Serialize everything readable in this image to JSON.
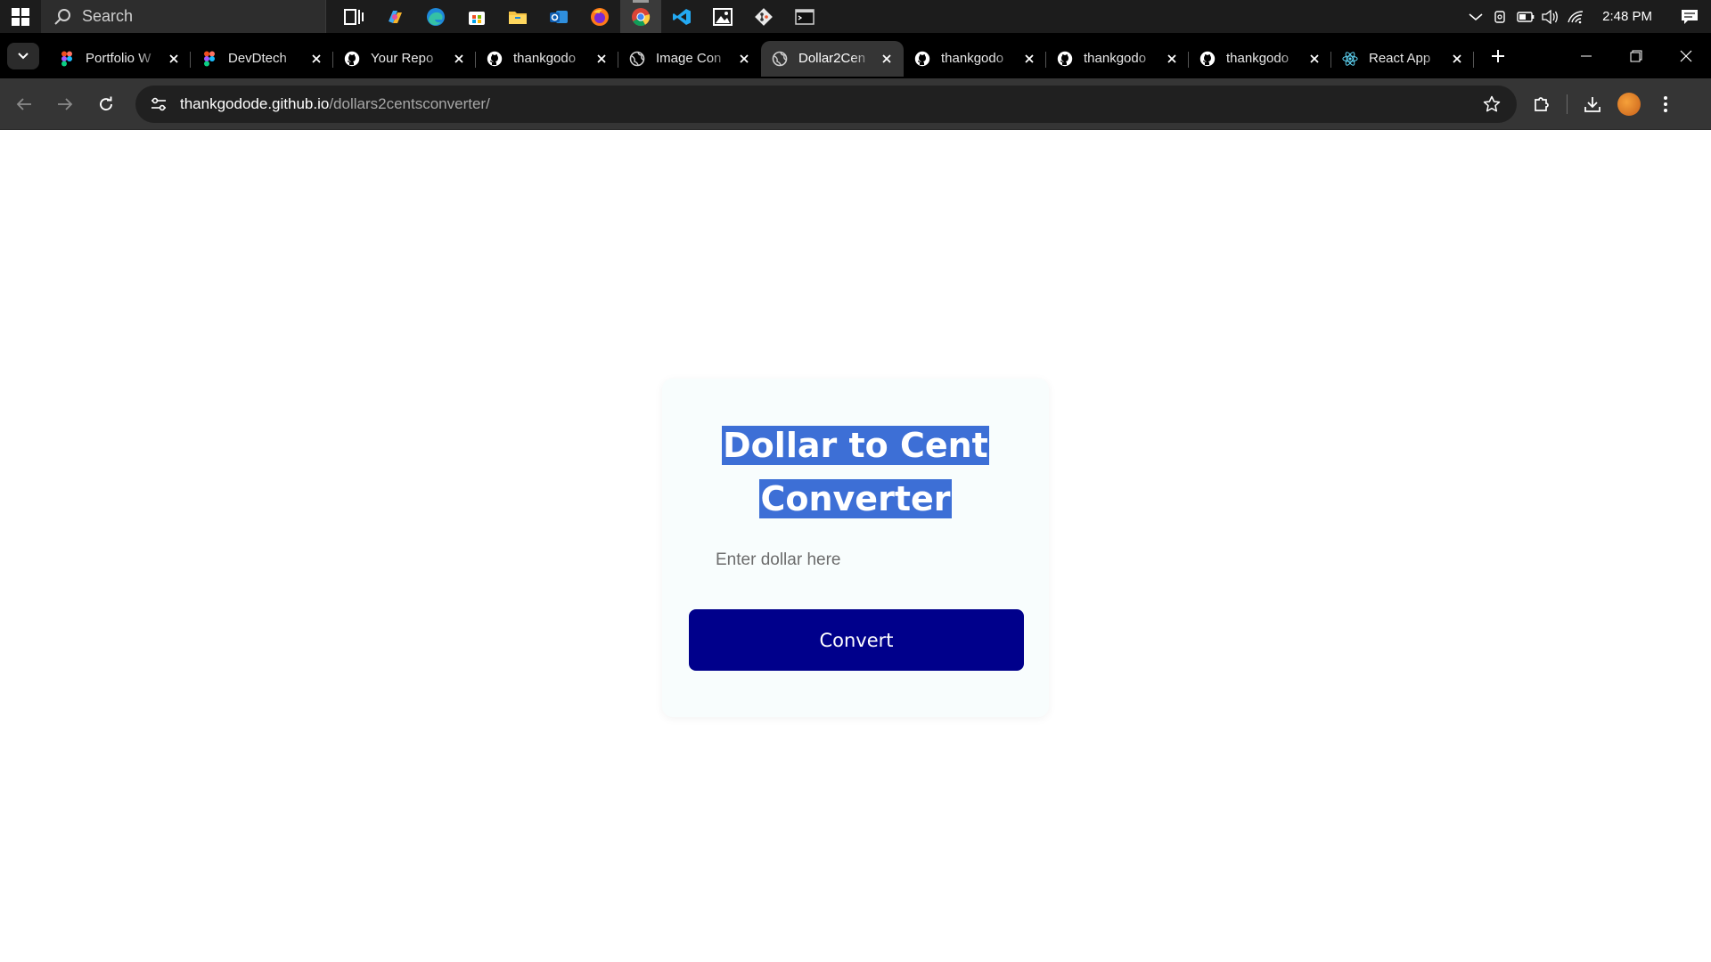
{
  "taskbar": {
    "search_label": "Search",
    "clock": "2:48 PM",
    "apps": [
      {
        "name": "task-view-icon",
        "active": false
      },
      {
        "name": "copilot-icon",
        "active": false
      },
      {
        "name": "edge-icon",
        "active": false
      },
      {
        "name": "store-icon",
        "active": false
      },
      {
        "name": "file-explorer-icon",
        "active": false
      },
      {
        "name": "outlook-icon",
        "active": false
      },
      {
        "name": "firefox-icon",
        "active": false
      },
      {
        "name": "chrome-icon",
        "active": true
      },
      {
        "name": "vscode-icon",
        "active": false
      },
      {
        "name": "photos-icon",
        "active": false
      },
      {
        "name": "git-icon",
        "active": false
      },
      {
        "name": "terminal-icon",
        "active": false
      }
    ]
  },
  "browser": {
    "tabs": [
      {
        "title": "Portfolio W",
        "icon": "figma-icon",
        "active": false
      },
      {
        "title": "DevDtech",
        "icon": "figma-icon",
        "active": false
      },
      {
        "title": "Your Repo",
        "icon": "github-icon",
        "active": false
      },
      {
        "title": "thankgodo",
        "icon": "github-icon",
        "active": false
      },
      {
        "title": "Image Con",
        "icon": "globe-icon",
        "active": false
      },
      {
        "title": "Dollar2Cen",
        "icon": "globe-icon",
        "active": true
      },
      {
        "title": "thankgodo",
        "icon": "github-icon",
        "active": false
      },
      {
        "title": "thankgodo",
        "icon": "github-icon",
        "active": false
      },
      {
        "title": "thankgodo",
        "icon": "github-icon",
        "active": false
      },
      {
        "title": "React App",
        "icon": "react-icon",
        "active": false
      }
    ],
    "url_domain": "thankgodode.github.io",
    "url_path": "/dollars2centsconverter/"
  },
  "app": {
    "title": "Dollar to Cent Converter",
    "title_line1": "Dollar to Cent",
    "title_line2": "Converter",
    "input_placeholder": "Enter dollar here",
    "input_value": "",
    "button_label": "Convert",
    "colors": {
      "button": "#00008b",
      "title_selection": "#3d6fd6",
      "card_background": "#f8fdfd"
    }
  }
}
